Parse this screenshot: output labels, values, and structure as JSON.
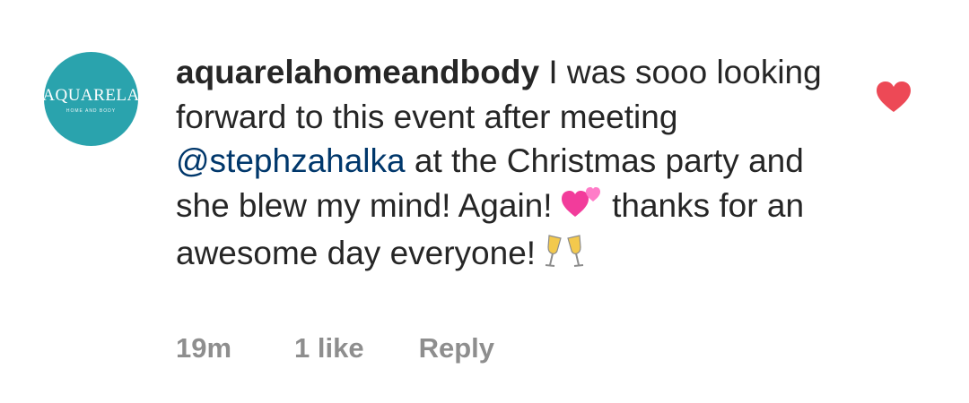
{
  "comment": {
    "avatar": {
      "wordmark": "AQUARELA",
      "tagline": "HOME AND BODY",
      "bg_color": "#2aa3ad"
    },
    "username": "aquarelahomeandbody",
    "text_1": "I was sooo looking forward to this event after meeting",
    "mention": "@stephzahalka",
    "text_2": "at the Christmas party and she blew my mind! Again!",
    "emoji_1": "two-hearts",
    "text_3": "thanks for an awesome day everyone!",
    "emoji_2": "clinking-glasses",
    "meta": {
      "time": "19m",
      "likes": "1 like",
      "reply": "Reply"
    },
    "like_icon": "heart-icon",
    "like_color": "#ed4956",
    "liked": true
  }
}
